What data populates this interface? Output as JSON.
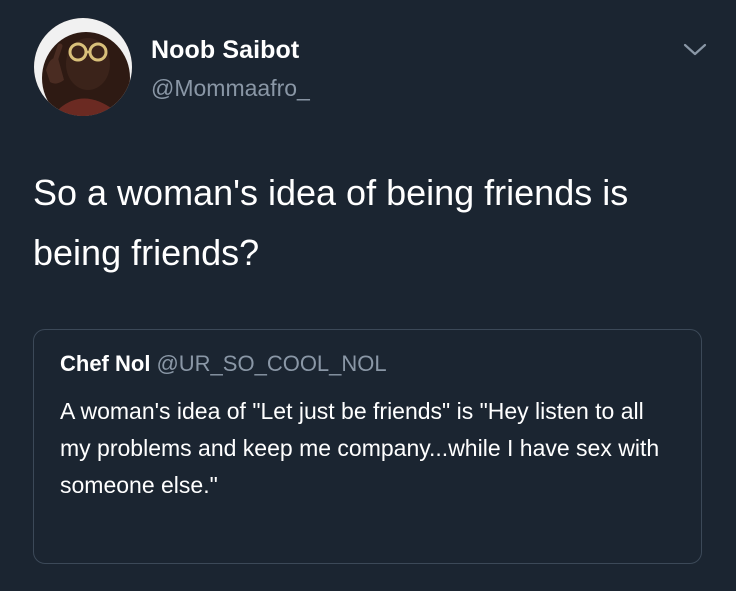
{
  "tweet": {
    "author": {
      "display_name": "Noob Saibot",
      "handle": "@Mommaafro_"
    },
    "text": "So a woman's idea of being friends is being friends?",
    "menu_icon": "chevron-down-icon"
  },
  "quoted_tweet": {
    "author": {
      "display_name": "Chef Nol",
      "handle": "@UR_SO_COOL_NOL"
    },
    "text": "A woman's idea of \"Let just be friends\" is \"Hey listen to all my problems and keep me company...while I have sex with someone else.\""
  },
  "colors": {
    "background": "#1b2531",
    "secondary_text": "#8a97a6",
    "quote_border": "#3c4958"
  }
}
